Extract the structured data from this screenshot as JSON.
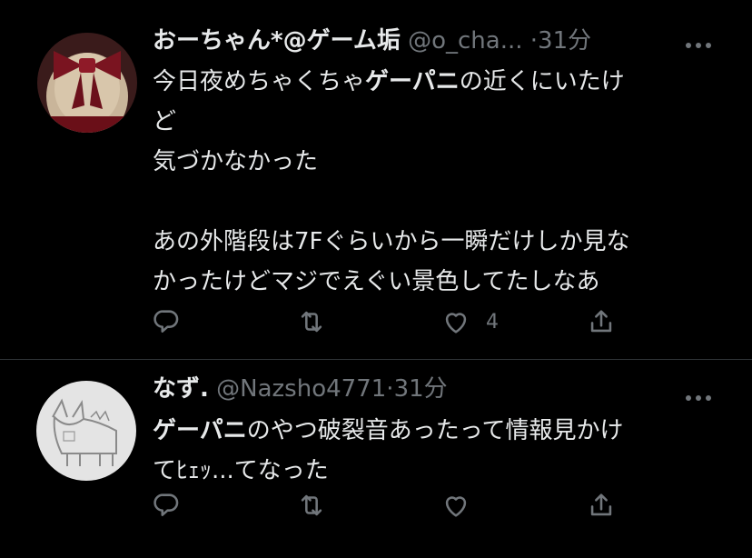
{
  "tweets": [
    {
      "display_name": "おーちゃん*@ゲーム垢",
      "handle": "@o_cha...",
      "separator": "·",
      "time": "31分",
      "body_line1_pre": "今日夜めちゃくちゃ",
      "body_line1_bold": "ゲーパニ",
      "body_line1_post": "の近くにいたけ",
      "body_rest": "ど\n気づかなかった\n\nあの外階段は7Fぐらいから一瞬だけしか見な\nかったけどマジでえぐい景色してたしなあ",
      "like_count": "4"
    },
    {
      "display_name": "なず.",
      "handle": "@Nazsho4771",
      "separator": "·",
      "time": "31分",
      "body_line1_bold": "ゲーパニ",
      "body_line1_post": "のやつ破裂音あったって情報見かけ",
      "body_rest": "てﾋｪｯ...てなった"
    }
  ],
  "colors": {
    "background": "#000000",
    "text": "#e7e9ea",
    "secondary": "#71767b",
    "divider": "#2f3336"
  },
  "icons": [
    "more-icon",
    "reply-icon",
    "retweet-icon",
    "like-icon",
    "share-icon"
  ]
}
